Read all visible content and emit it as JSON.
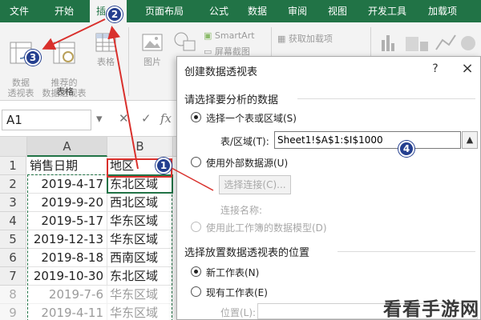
{
  "ribbon": {
    "tabs": [
      {
        "label": "文件"
      },
      {
        "label": "开始"
      },
      {
        "label": "插"
      },
      {
        "label": "页面布局"
      },
      {
        "label": "公式"
      },
      {
        "label": "数据"
      },
      {
        "label": "审阅"
      },
      {
        "label": "视图"
      },
      {
        "label": "开发工具"
      },
      {
        "label": "加载项"
      }
    ],
    "buttons": {
      "pivot": "数据\n透视表",
      "recommended_pivot": "推荐的\n数据透视表",
      "table": "表格",
      "pictures": "图片",
      "smartart": "SmartArt",
      "screenshot": "屏幕截图",
      "get_addins": "获取加载项"
    },
    "group_tables": "表格"
  },
  "formula_bar": {
    "name_box": "A1",
    "formula": ""
  },
  "sheet": {
    "columns": [
      "A",
      "B"
    ],
    "rows": [
      {
        "n": "1",
        "a": "销售日期",
        "b": "地区"
      },
      {
        "n": "2",
        "a": "2019-4-17",
        "b": "东北区域"
      },
      {
        "n": "3",
        "a": "2019-9-20",
        "b": "西北区域"
      },
      {
        "n": "4",
        "a": "2019-5-17",
        "b": "华东区域"
      },
      {
        "n": "5",
        "a": "2019-12-13",
        "b": "华东区域"
      },
      {
        "n": "6",
        "a": "2019-8-18",
        "b": "西南区域"
      },
      {
        "n": "7",
        "a": "2019-10-30",
        "b": "东北区域"
      },
      {
        "n": "8",
        "a": "2019-7-6",
        "b": "华东区域"
      },
      {
        "n": "9",
        "a": "2019-4-11",
        "b": "华东区域"
      }
    ]
  },
  "dialog": {
    "title": "创建数据透视表",
    "help": "?",
    "close": "×",
    "section1": "请选择要分析的数据",
    "opt_select_range": "选择一个表或区域(S)",
    "range_label": "表/区域(T):",
    "range_value": "Sheet1!$A$1:$I$1000",
    "opt_external": "使用外部数据源(U)",
    "choose_connection": "选择连接(C)...",
    "connection_name": "连接名称:",
    "opt_data_model": "使用此工作簿的数据模型(D)",
    "section2": "选择放置数据透视表的位置",
    "opt_new_sheet": "新工作表(N)",
    "opt_existing_sheet": "现有工作表(E)",
    "location_label": "位置(L):"
  },
  "badges": [
    "1",
    "2",
    "3",
    "4"
  ],
  "watermark": "看看手游网",
  "colors": {
    "excel_green": "#217346",
    "badge_blue": "#243f8f",
    "arrow_red": "#d9302c"
  }
}
